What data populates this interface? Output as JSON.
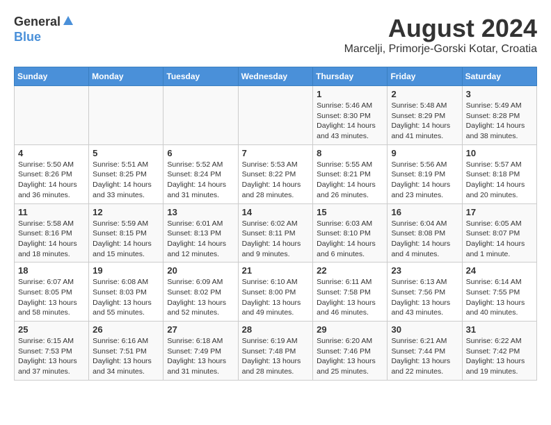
{
  "logo": {
    "general": "General",
    "blue": "Blue"
  },
  "title": "August 2024",
  "subtitle": "Marcelji, Primorje-Gorski Kotar, Croatia",
  "headers": [
    "Sunday",
    "Monday",
    "Tuesday",
    "Wednesday",
    "Thursday",
    "Friday",
    "Saturday"
  ],
  "weeks": [
    [
      {
        "day": "",
        "info": ""
      },
      {
        "day": "",
        "info": ""
      },
      {
        "day": "",
        "info": ""
      },
      {
        "day": "",
        "info": ""
      },
      {
        "day": "1",
        "info": "Sunrise: 5:46 AM\nSunset: 8:30 PM\nDaylight: 14 hours and 43 minutes."
      },
      {
        "day": "2",
        "info": "Sunrise: 5:48 AM\nSunset: 8:29 PM\nDaylight: 14 hours and 41 minutes."
      },
      {
        "day": "3",
        "info": "Sunrise: 5:49 AM\nSunset: 8:28 PM\nDaylight: 14 hours and 38 minutes."
      }
    ],
    [
      {
        "day": "4",
        "info": "Sunrise: 5:50 AM\nSunset: 8:26 PM\nDaylight: 14 hours and 36 minutes."
      },
      {
        "day": "5",
        "info": "Sunrise: 5:51 AM\nSunset: 8:25 PM\nDaylight: 14 hours and 33 minutes."
      },
      {
        "day": "6",
        "info": "Sunrise: 5:52 AM\nSunset: 8:24 PM\nDaylight: 14 hours and 31 minutes."
      },
      {
        "day": "7",
        "info": "Sunrise: 5:53 AM\nSunset: 8:22 PM\nDaylight: 14 hours and 28 minutes."
      },
      {
        "day": "8",
        "info": "Sunrise: 5:55 AM\nSunset: 8:21 PM\nDaylight: 14 hours and 26 minutes."
      },
      {
        "day": "9",
        "info": "Sunrise: 5:56 AM\nSunset: 8:19 PM\nDaylight: 14 hours and 23 minutes."
      },
      {
        "day": "10",
        "info": "Sunrise: 5:57 AM\nSunset: 8:18 PM\nDaylight: 14 hours and 20 minutes."
      }
    ],
    [
      {
        "day": "11",
        "info": "Sunrise: 5:58 AM\nSunset: 8:16 PM\nDaylight: 14 hours and 18 minutes."
      },
      {
        "day": "12",
        "info": "Sunrise: 5:59 AM\nSunset: 8:15 PM\nDaylight: 14 hours and 15 minutes."
      },
      {
        "day": "13",
        "info": "Sunrise: 6:01 AM\nSunset: 8:13 PM\nDaylight: 14 hours and 12 minutes."
      },
      {
        "day": "14",
        "info": "Sunrise: 6:02 AM\nSunset: 8:11 PM\nDaylight: 14 hours and 9 minutes."
      },
      {
        "day": "15",
        "info": "Sunrise: 6:03 AM\nSunset: 8:10 PM\nDaylight: 14 hours and 6 minutes."
      },
      {
        "day": "16",
        "info": "Sunrise: 6:04 AM\nSunset: 8:08 PM\nDaylight: 14 hours and 4 minutes."
      },
      {
        "day": "17",
        "info": "Sunrise: 6:05 AM\nSunset: 8:07 PM\nDaylight: 14 hours and 1 minute."
      }
    ],
    [
      {
        "day": "18",
        "info": "Sunrise: 6:07 AM\nSunset: 8:05 PM\nDaylight: 13 hours and 58 minutes."
      },
      {
        "day": "19",
        "info": "Sunrise: 6:08 AM\nSunset: 8:03 PM\nDaylight: 13 hours and 55 minutes."
      },
      {
        "day": "20",
        "info": "Sunrise: 6:09 AM\nSunset: 8:02 PM\nDaylight: 13 hours and 52 minutes."
      },
      {
        "day": "21",
        "info": "Sunrise: 6:10 AM\nSunset: 8:00 PM\nDaylight: 13 hours and 49 minutes."
      },
      {
        "day": "22",
        "info": "Sunrise: 6:11 AM\nSunset: 7:58 PM\nDaylight: 13 hours and 46 minutes."
      },
      {
        "day": "23",
        "info": "Sunrise: 6:13 AM\nSunset: 7:56 PM\nDaylight: 13 hours and 43 minutes."
      },
      {
        "day": "24",
        "info": "Sunrise: 6:14 AM\nSunset: 7:55 PM\nDaylight: 13 hours and 40 minutes."
      }
    ],
    [
      {
        "day": "25",
        "info": "Sunrise: 6:15 AM\nSunset: 7:53 PM\nDaylight: 13 hours and 37 minutes."
      },
      {
        "day": "26",
        "info": "Sunrise: 6:16 AM\nSunset: 7:51 PM\nDaylight: 13 hours and 34 minutes."
      },
      {
        "day": "27",
        "info": "Sunrise: 6:18 AM\nSunset: 7:49 PM\nDaylight: 13 hours and 31 minutes."
      },
      {
        "day": "28",
        "info": "Sunrise: 6:19 AM\nSunset: 7:48 PM\nDaylight: 13 hours and 28 minutes."
      },
      {
        "day": "29",
        "info": "Sunrise: 6:20 AM\nSunset: 7:46 PM\nDaylight: 13 hours and 25 minutes."
      },
      {
        "day": "30",
        "info": "Sunrise: 6:21 AM\nSunset: 7:44 PM\nDaylight: 13 hours and 22 minutes."
      },
      {
        "day": "31",
        "info": "Sunrise: 6:22 AM\nSunset: 7:42 PM\nDaylight: 13 hours and 19 minutes."
      }
    ]
  ]
}
